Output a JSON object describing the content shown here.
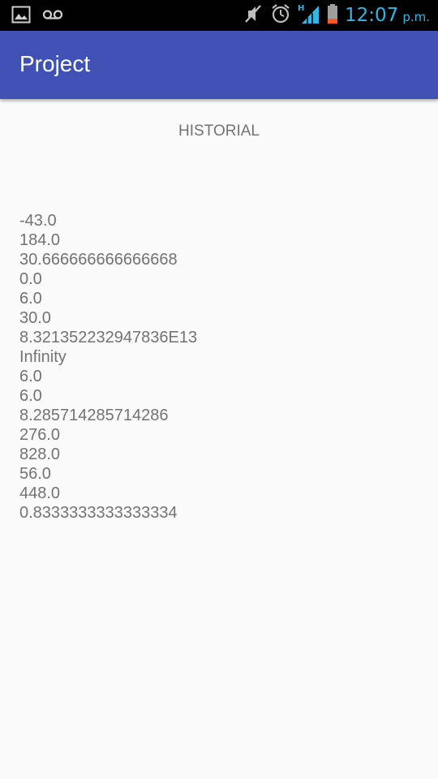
{
  "status_bar": {
    "time": "12:07",
    "ampm": "p.m.",
    "icons": [
      "image-icon",
      "voicemail-icon",
      "mute-icon",
      "alarm-icon",
      "signal-icon",
      "battery-icon"
    ],
    "accent_color": "#33b5e5",
    "network_type": "H"
  },
  "app_bar": {
    "title": "Project",
    "color": "#3f51b5"
  },
  "main": {
    "heading": "HISTORIAL",
    "history": [
      "-43.0",
      "184.0",
      "30.666666666666668",
      "0.0",
      "6.0",
      "30.0",
      "8.321352232947836E13",
      "Infinity",
      "6.0",
      "6.0",
      "8.285714285714286",
      "276.0",
      "828.0",
      "56.0",
      "448.0",
      "0.8333333333333334"
    ]
  }
}
